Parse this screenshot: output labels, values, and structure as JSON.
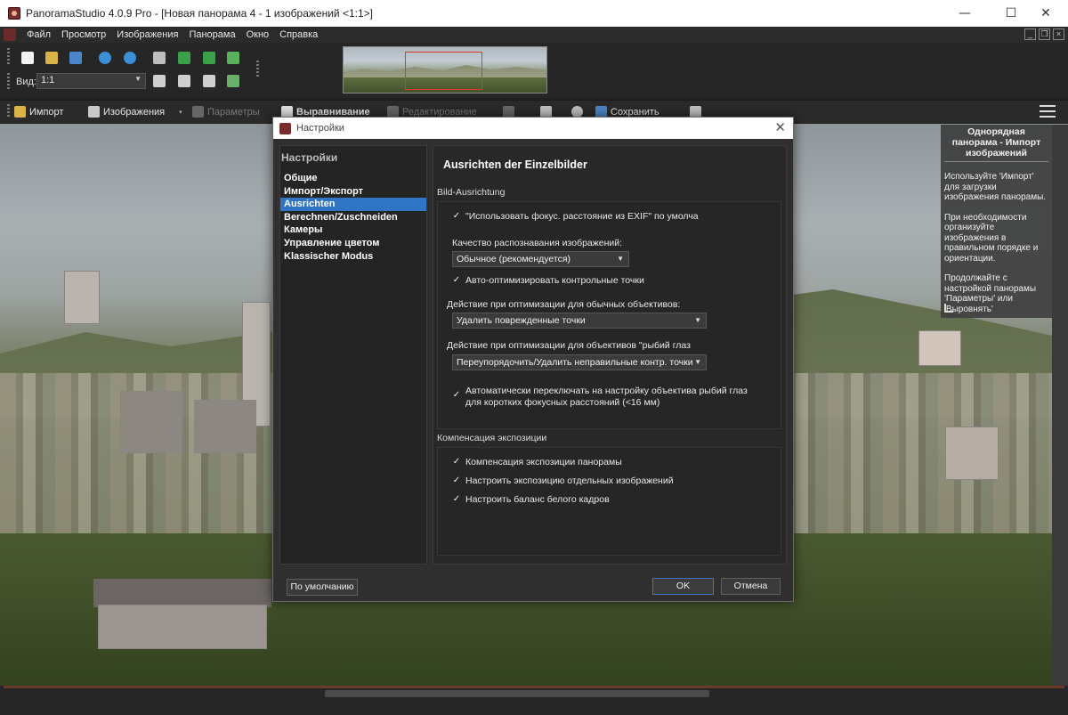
{
  "window": {
    "title": "PanoramaStudio 4.0.9 Pro - [Новая панорама 4 - 1 изображений <1:1>]",
    "minimize_glyph": "—",
    "maximize_glyph": "☐",
    "close_glyph": "✕"
  },
  "menu": {
    "items": [
      "Файл",
      "Просмотр",
      "Изображения",
      "Панорама",
      "Окно",
      "Справка"
    ]
  },
  "toolbar": {
    "view_label": "Вид:",
    "view_value": "1:1"
  },
  "toolbar2": {
    "import": "Импорт",
    "images": "Изображения",
    "parameters": "Параметры",
    "alignment": "Выравнивание",
    "editing": "Редактирование",
    "save": "Сохранить"
  },
  "help_panel": {
    "title": "Однорядная панорама - Импорт изображений",
    "paragraphs": [
      "Используйте 'Импорт' для загрузки изображения панорамы.",
      "При необходимости организуйте изображения в правильном порядке и ориентации.",
      "Продолжайте с настройкой панорамы 'Параметры' или 'Выровнять'"
    ]
  },
  "dialog": {
    "title": "Настройки",
    "close_glyph": "✕",
    "sidebar": {
      "header": "Настройки",
      "items": [
        "Общие",
        "Импорт/Экспорт",
        "Ausrichten",
        "Berechnen/Zuschneiden",
        "Камеры",
        "Управление цветом",
        "Klassischer Modus"
      ],
      "selected_index": 2
    },
    "content": {
      "title": "Ausrichten der Einzelbilder",
      "section1_label": "Bild-Ausrichtung",
      "use_exif": "\"Использовать фокус. расстояние из EXIF\" по умолча",
      "quality_label": "Качество распознавания изображений:",
      "quality_value": "Обычное (рекомендуется)",
      "auto_optimize": "Авто-оптимизировать контрольные точки",
      "normal_lens_label": "Действие при оптимизации для обычных объективов:",
      "normal_lens_value": "Удалить поврежденные точки",
      "fisheye_label": "Действие при оптимизации для объективов \"рыбий глаз",
      "fisheye_value": "Переупорядочить/Удалить неправильные контр. точки",
      "auto_switch_line1": "Автоматически переключать на настройку объектива рыбий глаз",
      "auto_switch_line2": "для коротких фокусных расстояний (<16 мм)",
      "section2_label": "Компенсация экспозиции",
      "exp_panorama": "Компенсация экспозиции панорамы",
      "exp_images": "Настроить экспозицию отдельных изображений",
      "white_balance": "Настроить баланс белого кадров",
      "check_glyph": "✓"
    },
    "buttons": {
      "default": "По умолчанию",
      "ok": "OK",
      "cancel": "Отмена"
    }
  }
}
